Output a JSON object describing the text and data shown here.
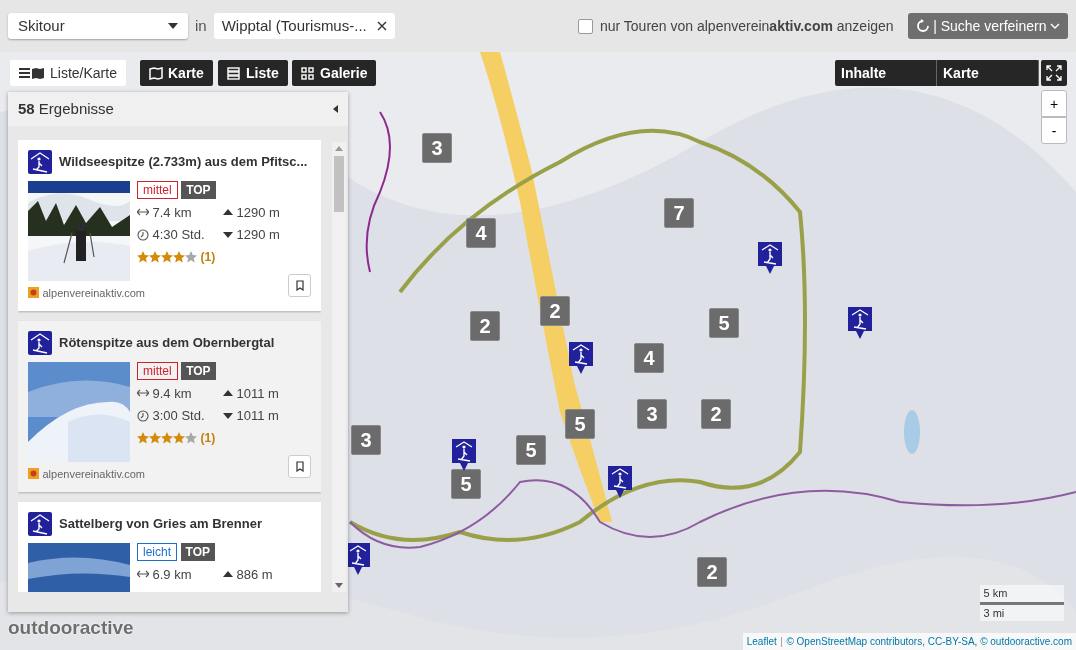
{
  "search": {
    "activity": "Skitour",
    "connector": "in",
    "location": "Wipptal (Tourismus-...",
    "filter_label": "nur Touren von alpenverein**aktiv.com** anzeigen",
    "filter_checked": false,
    "refine_button": "| Suche verfeinern"
  },
  "view_tabs": [
    {
      "label": "Liste/Karte",
      "selected": true
    },
    {
      "label": "Karte",
      "selected": false
    },
    {
      "label": "Liste",
      "selected": false
    },
    {
      "label": "Galerie",
      "selected": false
    }
  ],
  "results": {
    "count_text": "**58** Ergebnisse",
    "items": [
      {
        "title": "Wildseespitze (2.733m) aus dem Pfitsc...",
        "difficulty": "mittel",
        "color": "#d0202a",
        "badge": "TOP",
        "distance": "7.4 km",
        "duration": "4:30 Std.",
        "ascent": "1290 m",
        "descent": "1290 m",
        "stars": 4,
        "rating_count": "(1)",
        "source": "alpenvereinaktiv.com"
      },
      {
        "title": "Rötenspitze aus dem Obernbergtal",
        "difficulty": "mittel",
        "color": "#d0202a",
        "badge": "TOP",
        "distance": "9.4 km",
        "duration": "3:00 Std.",
        "ascent": "1011 m",
        "descent": "1011 m",
        "stars": 4,
        "rating_count": "(1)",
        "source": "alpenvereinaktiv.com"
      },
      {
        "title": "Sattelberg von Gries am Brenner",
        "difficulty": "leicht",
        "color": "#1a6fd1",
        "badge": "TOP",
        "distance": "6.9 km",
        "ascent": "886 m"
      }
    ]
  },
  "map_tabs": [
    {
      "label": "Inhalte"
    },
    {
      "label": "Karte"
    }
  ],
  "zoom": {
    "in": "+",
    "out": "-"
  },
  "markers": [
    {
      "kind": "cluster",
      "label": "3"
    },
    {
      "kind": "cluster",
      "label": "4"
    },
    {
      "kind": "cluster",
      "label": "7"
    },
    {
      "kind": "cluster",
      "label": "2"
    },
    {
      "kind": "cluster",
      "label": "2"
    },
    {
      "kind": "cluster",
      "label": "4"
    },
    {
      "kind": "cluster",
      "label": "5"
    },
    {
      "kind": "cluster",
      "label": "3"
    },
    {
      "kind": "cluster",
      "label": "3"
    },
    {
      "kind": "cluster",
      "label": "2"
    },
    {
      "kind": "cluster",
      "label": "5"
    },
    {
      "kind": "cluster",
      "label": "5"
    },
    {
      "kind": "cluster",
      "label": "5"
    },
    {
      "kind": "cluster",
      "label": "2"
    },
    {
      "kind": "tour"
    },
    {
      "kind": "tour"
    },
    {
      "kind": "tour"
    },
    {
      "kind": "tour"
    },
    {
      "kind": "tour"
    },
    {
      "kind": "tour"
    }
  ],
  "logo": "outdooractive",
  "scale": {
    "metric": "5 km",
    "imperial": "3 mi"
  },
  "attribution": {
    "link": "Leaflet",
    "separator": "|",
    "text": "© OpenStreetMap contributors, CC-BY-SA, © outdooractive.com"
  }
}
